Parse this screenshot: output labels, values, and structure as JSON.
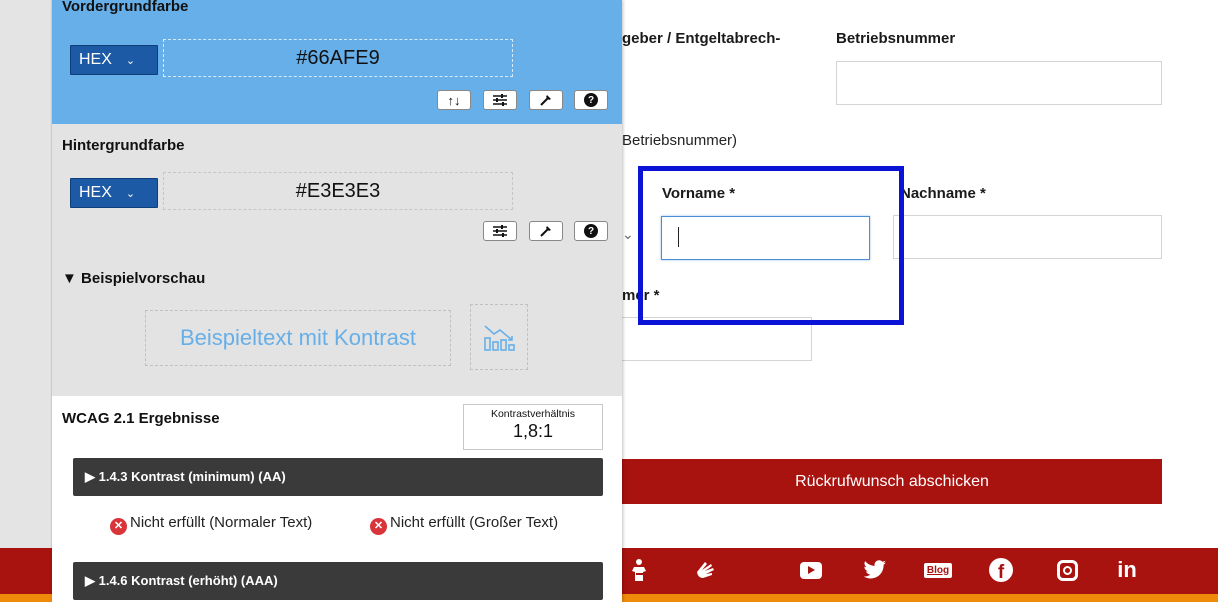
{
  "form": {
    "label_arbeitgeber": "geber / Entgeltabrech-",
    "label_betriebsnummer": "Betriebsnummer",
    "label_betriebsnummer_note": "Betriebsnummer)",
    "label_vorname": "Vorname *",
    "label_nachname": "Nachname *",
    "label_nummer": "mer *",
    "submit_label": "Rückrufwunsch abschicken"
  },
  "footer": {
    "social_icons": [
      "sign-language-icon",
      "hand-sign-icon",
      "youtube-icon",
      "twitter-icon",
      "blog-icon",
      "facebook-icon",
      "instagram-icon",
      "linkedin-icon"
    ],
    "blog_label": "Blog",
    "linkedin_label": "in",
    "colors": {
      "bar": "#a8120f",
      "stripe": "#f08a0a"
    }
  },
  "panel": {
    "foreground": {
      "title": "Vordergrundfarbe",
      "format": "HEX",
      "value": "#66AFE9",
      "tools": [
        "swap-icon",
        "sliders-icon",
        "eyedropper-icon",
        "help-icon"
      ]
    },
    "background": {
      "title": "Hintergrundfarbe",
      "format": "HEX",
      "value": "#E3E3E3",
      "tools": [
        "sliders-icon",
        "eyedropper-icon",
        "help-icon"
      ]
    },
    "preview": {
      "title": "▼ Beispielvorschau",
      "sample_text": "Beispieltext mit Kontrast"
    },
    "wcag": {
      "title": "WCAG 2.1 Ergebnisse",
      "ratio_label": "Kontrastverhältnis",
      "ratio_value": "1,8:1",
      "criteria": [
        {
          "label": "▶ 1.4.3 Kontrast (minimum) (AA)",
          "result_normal": "Nicht erfüllt (Normaler Text)",
          "result_large": "Nicht erfüllt (Großer Text)"
        },
        {
          "label": "▶ 1.4.6 Kontrast (erhöht) (AAA)"
        }
      ]
    },
    "colors": {
      "foreground": "#66AFE9",
      "background": "#E3E3E3",
      "select": "#1c5aa5"
    }
  },
  "highlight_color": "#0b14d6"
}
